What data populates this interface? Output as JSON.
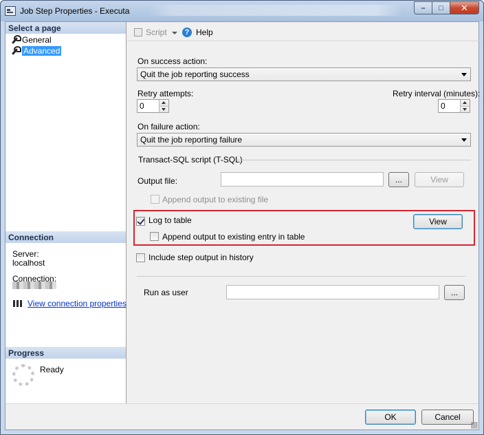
{
  "window": {
    "title": "Job Step Properties - Executa",
    "buttons": {
      "minimize": "–",
      "maximize": "□",
      "close": "✕"
    }
  },
  "sidebar": {
    "select_page_header": "Select a page",
    "pages": [
      {
        "label": "General",
        "icon": "wrench-icon",
        "selected": false
      },
      {
        "label": "Advanced",
        "icon": "wrench-icon",
        "selected": true
      }
    ],
    "connection_header": "Connection",
    "server_label": "Server:",
    "server_value": "localhost",
    "connection_label": "Connection:",
    "view_connection_link": "View connection properties",
    "progress_header": "Progress",
    "progress_status": "Ready"
  },
  "toolbar": {
    "script_label": "Script",
    "help_label": "Help"
  },
  "form": {
    "on_success_label": "On success action:",
    "on_success_value": "Quit the job reporting success",
    "retry_attempts_label": "Retry attempts:",
    "retry_attempts_value": "0",
    "retry_interval_label": "Retry interval (minutes):",
    "retry_interval_value": "0",
    "on_failure_label": "On failure action:",
    "on_failure_value": "Quit the job reporting failure",
    "tsql_section_label": "Transact-SQL script (T-SQL)",
    "output_file_label": "Output file:",
    "output_file_value": "",
    "browse_label": "...",
    "view_output_label": "View",
    "append_output_file_label": "Append output to existing file",
    "log_to_table_label": "Log to table",
    "log_to_table_checked": true,
    "view_table_label": "View",
    "append_entry_label": "Append output to existing entry in table",
    "include_history_label": "Include step output in history",
    "run_as_user_label": "Run as user",
    "run_as_user_value": "",
    "run_as_browse_label": "..."
  },
  "footer": {
    "ok_label": "OK",
    "cancel_label": "Cancel"
  }
}
